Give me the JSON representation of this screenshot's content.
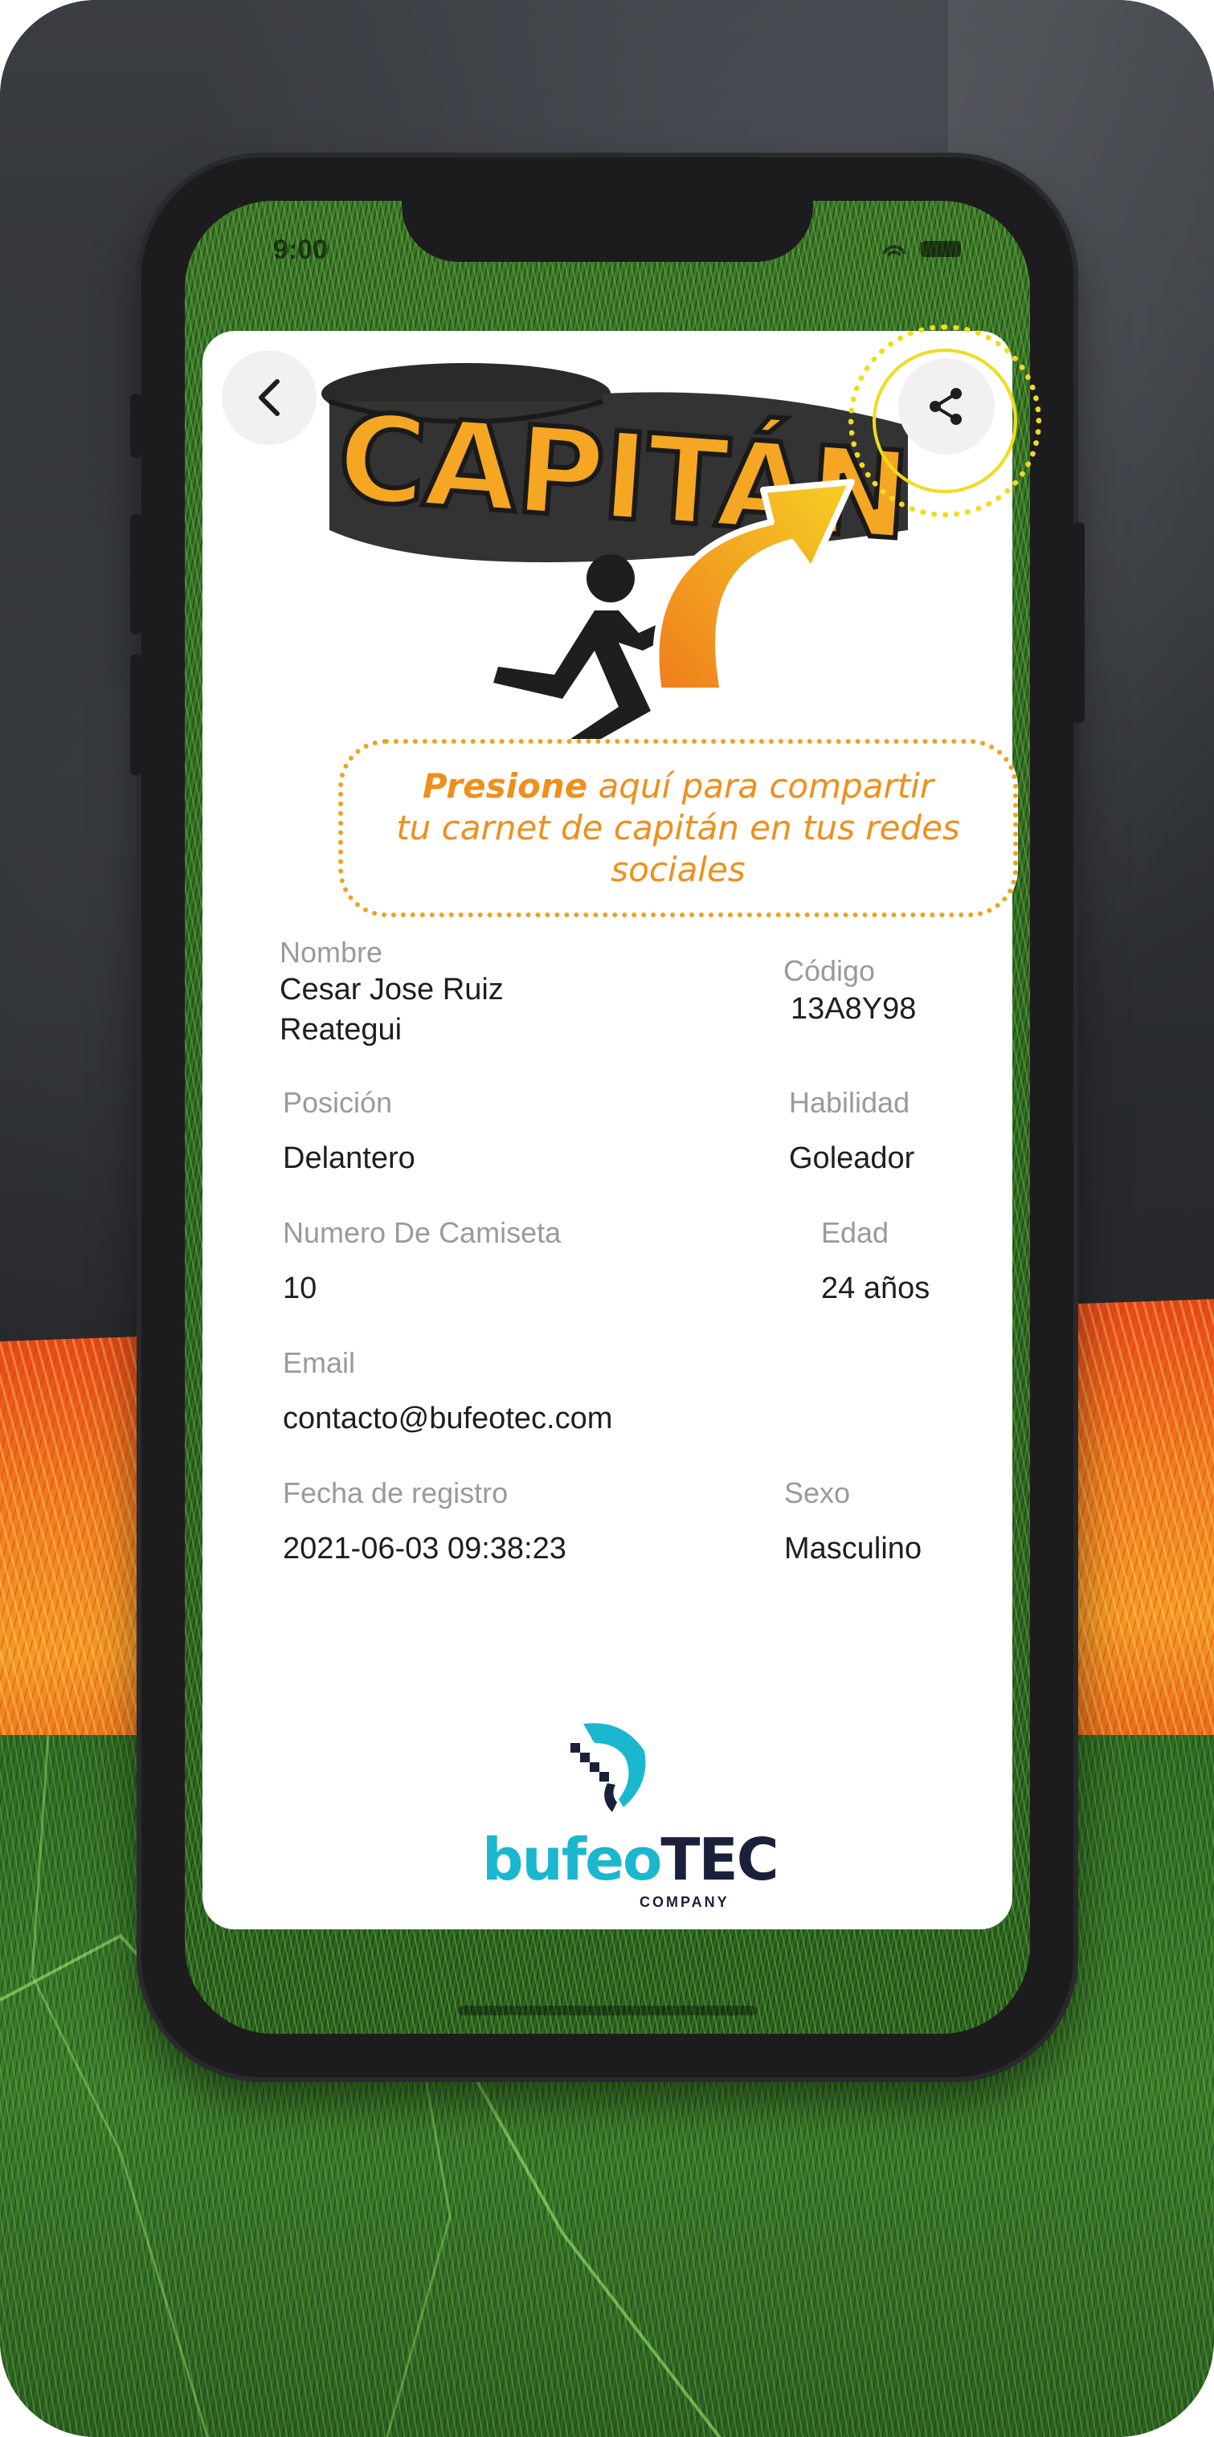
{
  "status_bar": {
    "time": "9:00"
  },
  "header": {
    "back_icon": "chevron-left-icon",
    "share_icon": "share-icon",
    "badge_title": "CAPITÁN"
  },
  "tooltip": {
    "highlight": "Presione",
    "rest_line1": " aquí para compartir",
    "line2": "tu carnet de capitán en tus redes",
    "line3": "sociales"
  },
  "profile": {
    "nombre_label": "Nombre",
    "nombre_line1": "Cesar Jose Ruiz",
    "nombre_line2": "Reategui",
    "codigo_label": "Código",
    "codigo_value": "13A8Y98",
    "posicion_label": "Posición",
    "posicion_value": "Delantero",
    "habilidad_label": "Habilidad",
    "habilidad_value": "Goleador",
    "camiseta_label": "Numero De Camiseta",
    "camiseta_value": "10",
    "edad_label": "Edad",
    "edad_value": "24 años",
    "email_label": "Email",
    "email_value": "contacto@bufeotec.com",
    "registro_label": "Fecha de registro",
    "registro_value": "2021-06-03 09:38:23",
    "sexo_label": "Sexo",
    "sexo_value": "Masculino"
  },
  "brand": {
    "bufeo": "bufeo",
    "tec": "TEC",
    "company": "COMPANY"
  },
  "colors": {
    "accent_orange": "#ef8f1c",
    "highlight_yellow": "#f0dc1c",
    "brand_cyan": "#1bb7cf",
    "brand_navy": "#1a1f3a"
  }
}
